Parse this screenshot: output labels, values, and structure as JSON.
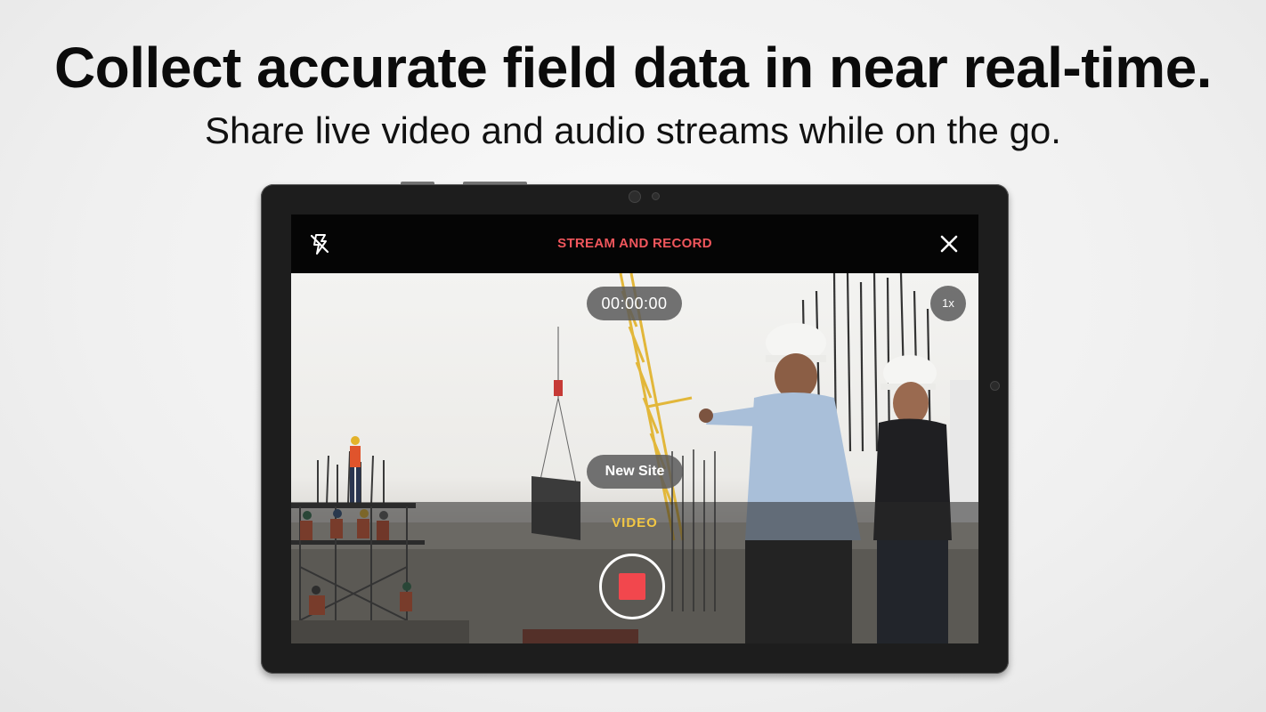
{
  "headline": "Collect accurate field data in near real-time.",
  "subheadline": "Share live video and audio streams while on the go.",
  "camera_app": {
    "title": "STREAM AND RECORD",
    "flash_icon": "flash-off-icon",
    "close_icon": "close-icon",
    "timer": "00:00:00",
    "zoom": "1x",
    "site_label": "New Site",
    "mode": "VIDEO",
    "record_icon": "stop-icon"
  },
  "colors": {
    "title": "#f0565c",
    "mode": "#f2c744",
    "record": "#f2474d"
  }
}
